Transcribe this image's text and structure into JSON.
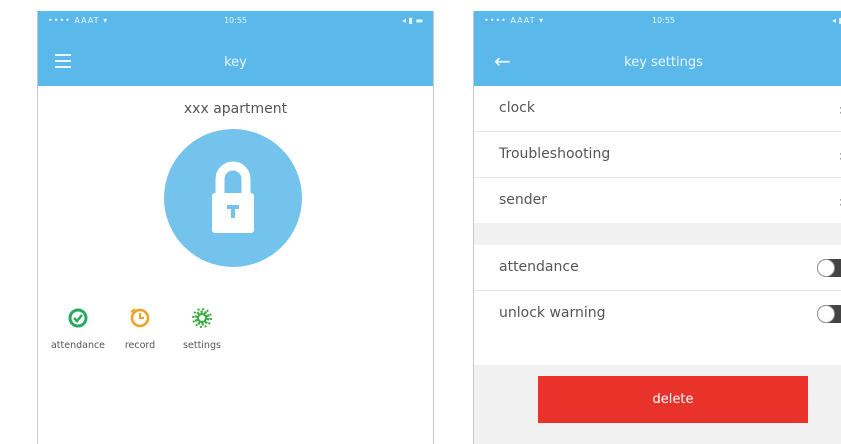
{
  "colors": {
    "header": "#5ab8ea",
    "lock_circle": "#74c3ec",
    "delete": "#e8322a",
    "attendance_icon": "#2aa860",
    "record_icon": "#f0a020",
    "settings_icon": "#3aaa40"
  },
  "left_screen": {
    "status": {
      "carrier": "•••• AAAT ▾",
      "time": "10:55",
      "battery": "◂ ▮ ▬"
    },
    "title": "key",
    "apartment_title": "xxx apartment",
    "actions": [
      {
        "label": "attendance",
        "icon": "check-circle-icon"
      },
      {
        "label": "record",
        "icon": "clock-icon"
      },
      {
        "label": "settings",
        "icon": "gear-icon"
      }
    ]
  },
  "right_screen": {
    "status": {
      "carrier": "•••• AAAT ▾",
      "time": "10:55",
      "battery": "◂ ▮"
    },
    "title": "key settings",
    "rows": [
      {
        "label": "clock",
        "chevron": "›"
      },
      {
        "label": "Troubleshooting",
        "chevron": "›"
      },
      {
        "label": "sender",
        "chevron": "›"
      }
    ],
    "toggles": [
      {
        "label": "attendance",
        "on": false
      },
      {
        "label": "unlock warning",
        "on": false
      }
    ],
    "delete_label": "delete"
  }
}
